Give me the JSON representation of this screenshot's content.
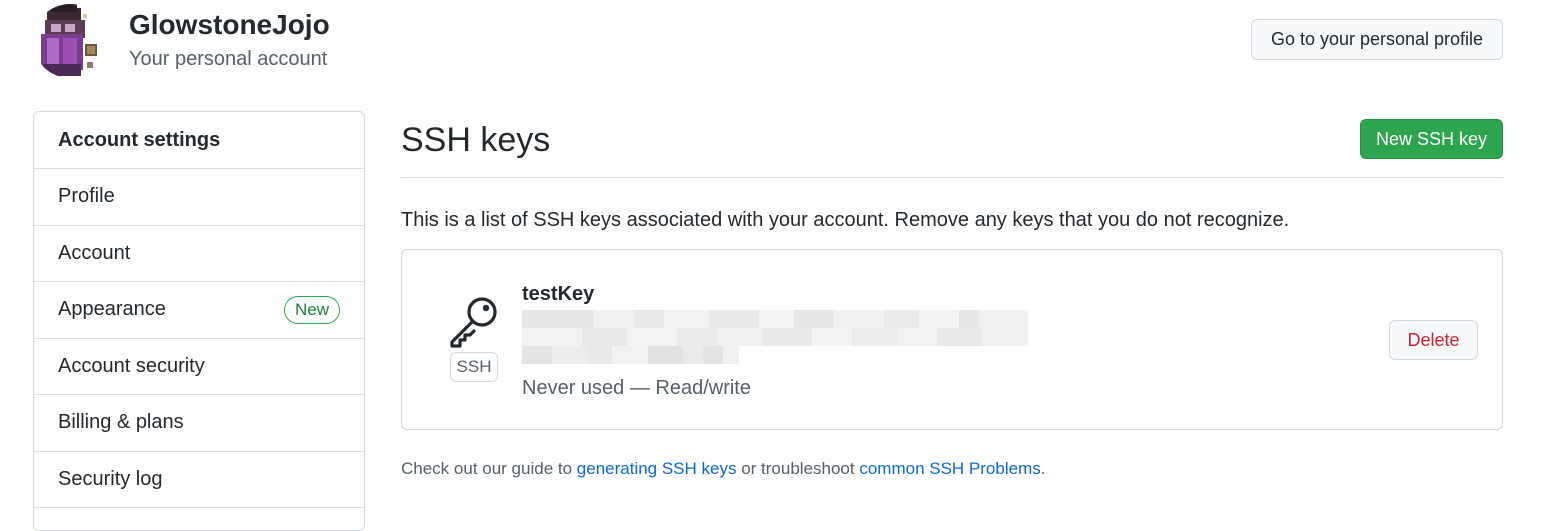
{
  "header": {
    "username": "GlowstoneJojo",
    "subtitle": "Your personal account",
    "profile_button": "Go to your personal profile"
  },
  "sidebar": {
    "heading": "Account settings",
    "items": [
      {
        "label": "Profile"
      },
      {
        "label": "Account"
      },
      {
        "label": "Appearance",
        "badge": "New"
      },
      {
        "label": "Account security"
      },
      {
        "label": "Billing & plans"
      },
      {
        "label": "Security log"
      }
    ]
  },
  "main": {
    "title": "SSH keys",
    "new_key_button": "New SSH key",
    "description": "This is a list of SSH keys associated with your account. Remove any keys that you do not recognize.",
    "keys": [
      {
        "name": "testKey",
        "type_label": "SSH",
        "usage": "Never used — Read/write",
        "delete_label": "Delete",
        "icon": "key-icon"
      }
    ],
    "footer": {
      "prefix": "Check out our guide to ",
      "link1": "generating SSH keys",
      "middle": " or troubleshoot ",
      "link2": "common SSH Problems",
      "suffix": "."
    }
  },
  "colors": {
    "primary_button": "#2da44e",
    "link": "#0969da",
    "danger": "#cf222e",
    "border": "#d0d7de",
    "badge_green": "#1a7f37"
  }
}
